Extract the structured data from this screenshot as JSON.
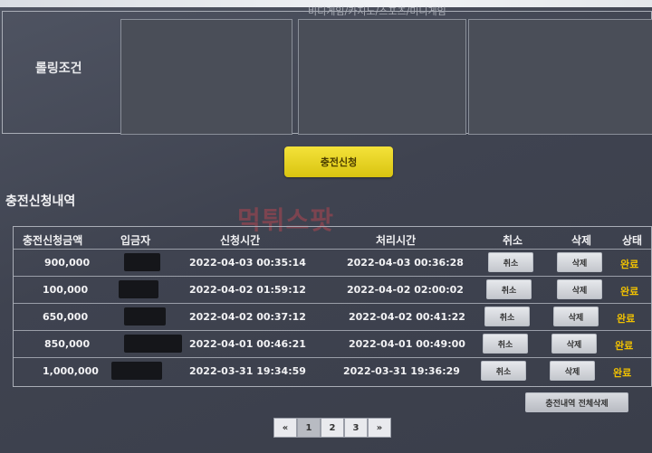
{
  "top": {
    "caption": "비디게임/카지노/스포츠/미니게임"
  },
  "rolling": {
    "label": "롤링조건"
  },
  "request_button": "충전신청",
  "section_title": "충전신청내역",
  "watermark": "먹튀스팟",
  "table": {
    "headers": [
      "충전신청금액",
      "입금자",
      "신청시간",
      "처리시간",
      "취소",
      "삭제",
      "상태"
    ],
    "rows": [
      {
        "amount": "900,000",
        "requested": "2022-04-03 00:35:14",
        "processed": "2022-04-03 00:36:28",
        "cancel": "취소",
        "delete": "삭제",
        "status": "완료"
      },
      {
        "amount": "100,000",
        "requested": "2022-04-02 01:59:12",
        "processed": "2022-04-02 02:00:02",
        "cancel": "취소",
        "delete": "삭제",
        "status": "완료"
      },
      {
        "amount": "650,000",
        "requested": "2022-04-02 00:37:12",
        "processed": "2022-04-02 00:41:22",
        "cancel": "취소",
        "delete": "삭제",
        "status": "완료"
      },
      {
        "amount": "850,000",
        "requested": "2022-04-01 00:46:21",
        "processed": "2022-04-01 00:49:00",
        "cancel": "취소",
        "delete": "삭제",
        "status": "완료"
      },
      {
        "amount": "1,000,000",
        "requested": "2022-03-31 19:34:59",
        "processed": "2022-03-31 19:36:29",
        "cancel": "취소",
        "delete": "삭제",
        "status": "완료"
      }
    ]
  },
  "delete_all_button": "충전내역 전체삭제",
  "pagination": {
    "prev": "«",
    "pages": [
      "1",
      "2",
      "3"
    ],
    "next": "»",
    "current": "1"
  },
  "colors": {
    "accent": "#f4e23a",
    "status": "#f2c200",
    "background": "#454955"
  }
}
